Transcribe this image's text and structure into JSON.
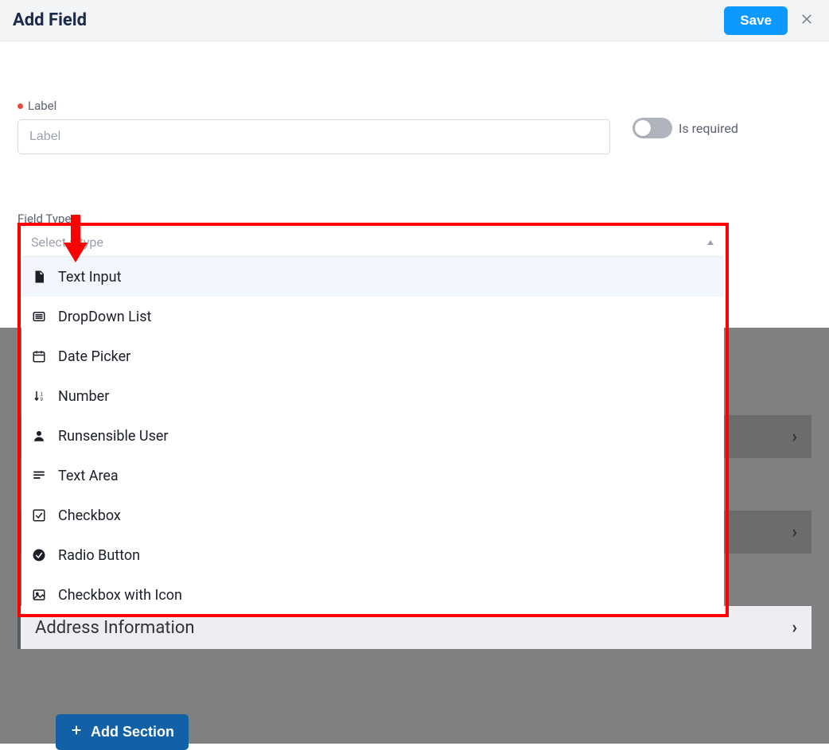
{
  "header": {
    "title": "Add Field",
    "save_label": "Save"
  },
  "form": {
    "label_field_label": "Label",
    "label_placeholder": "Label",
    "required_toggle_label": "Is required",
    "field_type_label": "Field Type"
  },
  "dropdown": {
    "placeholder": "Select a type",
    "options": [
      {
        "label": "Text Input",
        "icon": "file-text-icon"
      },
      {
        "label": "DropDown List",
        "icon": "list-icon"
      },
      {
        "label": "Date Picker",
        "icon": "calendar-icon"
      },
      {
        "label": "Number",
        "icon": "number-sort-icon"
      },
      {
        "label": "Runsensible User",
        "icon": "user-icon"
      },
      {
        "label": "Text Area",
        "icon": "lines-icon"
      },
      {
        "label": "Checkbox",
        "icon": "checkbox-icon"
      },
      {
        "label": "Radio Button",
        "icon": "radio-icon"
      },
      {
        "label": "Checkbox with Icon",
        "icon": "image-icon"
      }
    ]
  },
  "sections": {
    "visible_section": "Address Information",
    "add_section_label": "Add Section"
  },
  "annotation": {
    "highlight_color": "#ff0000"
  }
}
